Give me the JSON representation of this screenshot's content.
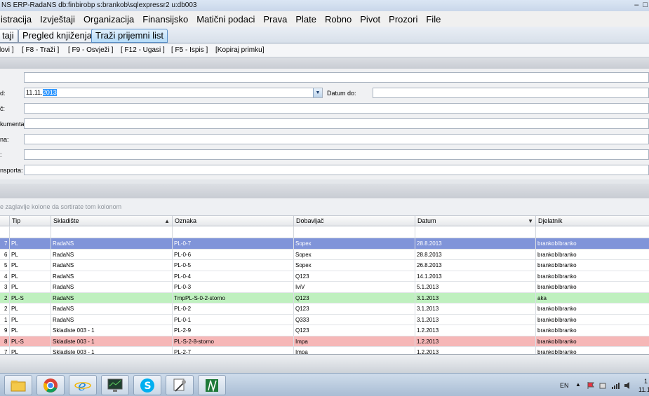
{
  "window": {
    "title": "NS ERP-RadaNS db:finbirobp s:brankob\\sqlexpressr2 u:db003"
  },
  "menu": [
    "istracija",
    "Izvještaji",
    "Organizacija",
    "Finansijsko",
    "Matični podaci",
    "Prava",
    "Plate",
    "Robno",
    "Pivot",
    "Prozori",
    "File"
  ],
  "tabs": [
    "taji",
    "Pregled knjiženja",
    "Traži prijemni list"
  ],
  "toolbar": [
    "lovi ]",
    "[ F8 - Traži ]",
    "[ F9 - Osvježi ]",
    "[ F12 - Ugasi ]",
    "[ F5 - Ispis ]",
    "[Kopiraj primku]"
  ],
  "form": {
    "datum_od_label": "d:",
    "datum_od_value_plain": "11.11.",
    "datum_od_value_selected": "2013",
    "datum_do_label": "Datum do:",
    "label3": "č:",
    "label4": "kumenta:",
    "label5": "na:",
    "label6": ":",
    "label7": "nsporta:"
  },
  "grid": {
    "group_hint": "e zaglavlje kolone da sortirate tom kolonom",
    "columns": [
      "Tip",
      "Skladište",
      "Oznaka",
      "Dobavljač",
      "Datum",
      "Djelatnik"
    ],
    "rows": [
      [
        "7",
        "PL",
        "RadaNS",
        "PL-0-7",
        "Sopex",
        "28.8.2013",
        "brankob\\branko"
      ],
      [
        "6",
        "PL",
        "RadaNS",
        "PL-0-6",
        "Sopex",
        "28.8.2013",
        "brankob\\branko"
      ],
      [
        "5",
        "PL",
        "RadaNS",
        "PL-0-5",
        "Sopex",
        "26.8.2013",
        "brankob\\branko"
      ],
      [
        "4",
        "PL",
        "RadaNS",
        "PL-0-4",
        "Q123",
        "14.1.2013",
        "brankob\\branko"
      ],
      [
        "3",
        "PL",
        "RadaNS",
        "PL-0-3",
        "IviV",
        "5.1.2013",
        "brankob\\branko"
      ],
      [
        "2",
        "PL-S",
        "RadaNS",
        "TmpPL-S-0-2-storno",
        "Q123",
        "3.1.2013",
        "aka"
      ],
      [
        "2",
        "PL",
        "RadaNS",
        "PL-0-2",
        "Q123",
        "3.1.2013",
        "brankob\\branko"
      ],
      [
        "1",
        "PL",
        "RadaNS",
        "PL-0-1",
        "Q333",
        "3.1.2013",
        "brankob\\branko"
      ],
      [
        "9",
        "PL",
        "Skladiste 003 - 1",
        "PL-2-9",
        "Q123",
        "1.2.2013",
        "brankob\\branko"
      ],
      [
        "8",
        "PL-S",
        "Skladiste 003 - 1",
        "PL-S-2-8-storno",
        "Impa",
        "1.2.2013",
        "brankob\\branko"
      ],
      [
        "7",
        "PL",
        "Skladiste 003 - 1",
        "PL-2-7",
        "Impa",
        "1.2.2013",
        "brankob\\branko"
      ]
    ]
  },
  "tray": {
    "lang": "EN",
    "clock_line1": "1",
    "clock_line2": "11.1"
  },
  "colors": {
    "selected_row": "#8094d9",
    "storno_green": "#bff0bf",
    "storno_red": "#f6b7b7",
    "accent": "#3399ff"
  }
}
